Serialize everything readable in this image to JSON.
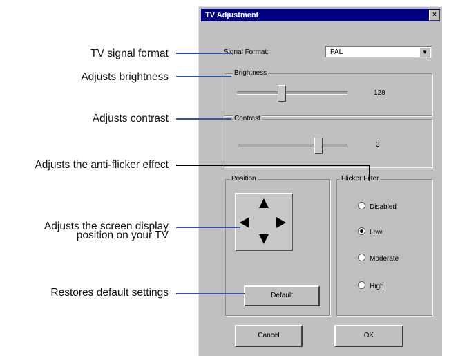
{
  "annotations": {
    "signal_format": "TV signal format",
    "brightness": "Adjusts brightness",
    "contrast": "Adjusts contrast",
    "flicker": "Adjusts the anti-flicker effect",
    "position_line1": "Adjusts the screen display",
    "position_line2": "position on your TV",
    "default": "Restores default settings"
  },
  "dialog": {
    "title": "TV Adjustment",
    "close_glyph": "×",
    "signal_format_label": "Signal Format:",
    "signal_format_value": "PAL",
    "dropdown_glyph": "▼",
    "brightness": {
      "label": "Brightness",
      "value": "128"
    },
    "contrast": {
      "label": "Contrast",
      "value": "3"
    },
    "position": {
      "label": "Position"
    },
    "flicker_filter": {
      "label": "Flicker Filter",
      "options": [
        "Disabled",
        "Low",
        "Moderate",
        "High"
      ],
      "selected": "Low"
    },
    "buttons": {
      "default": "Default",
      "cancel": "Cancel",
      "ok": "OK"
    }
  },
  "colors": {
    "line_blue": "#2f55a4",
    "line_black": "#000000",
    "titlebar": "#000080"
  }
}
